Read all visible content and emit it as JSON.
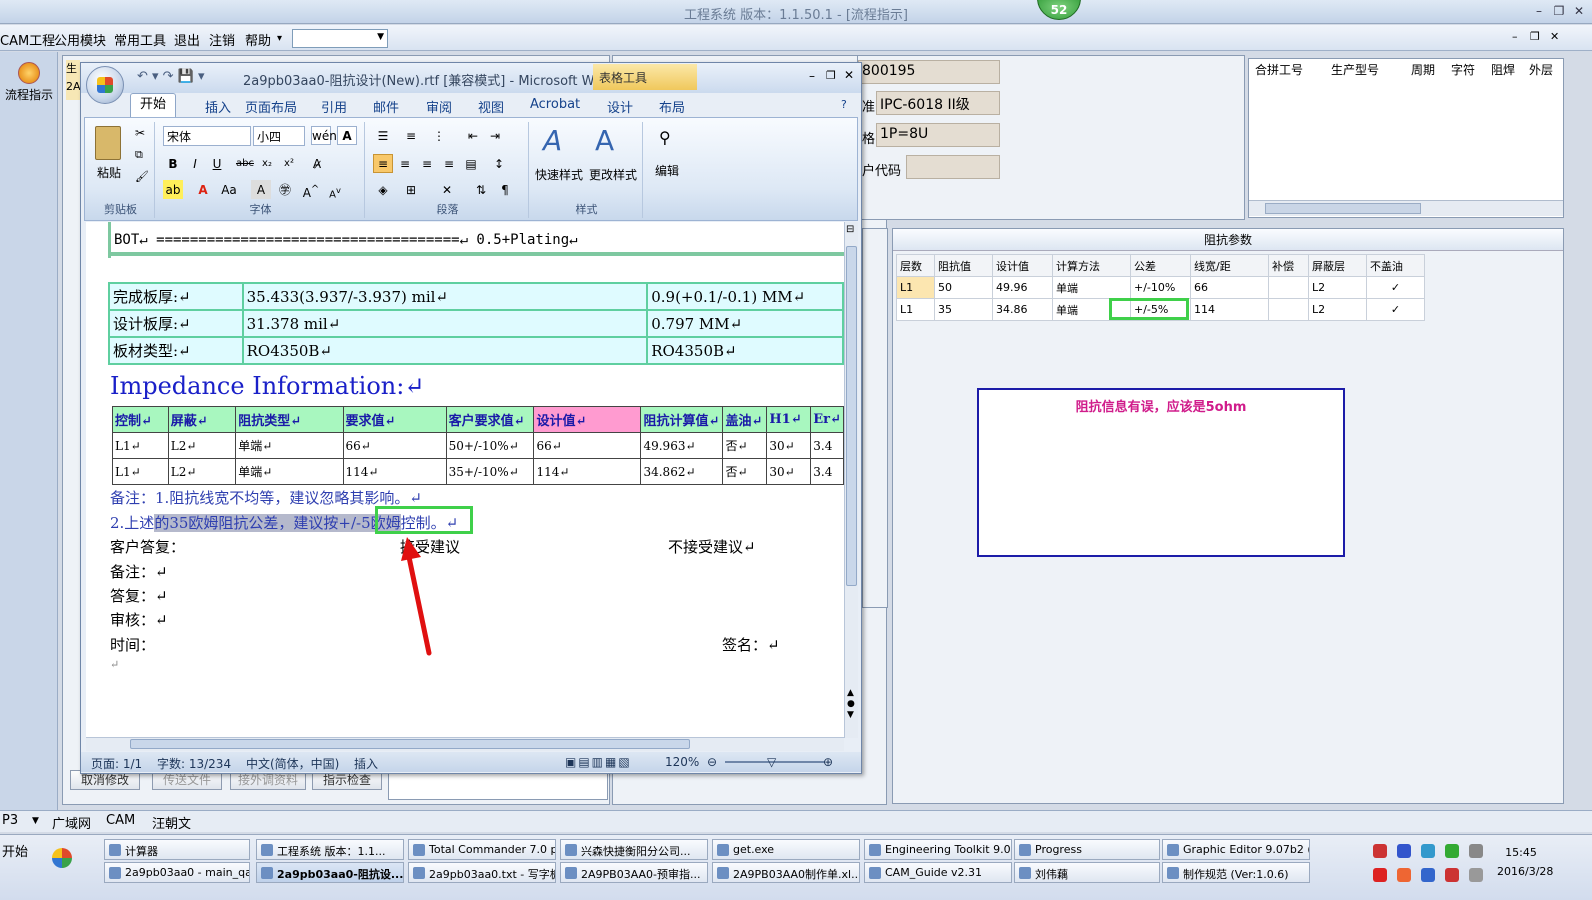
{
  "app": {
    "title": "工程系统   版本：1.1.50.1 - [流程指示]",
    "badge": "52",
    "menu": [
      "CAM工程",
      "公用模块",
      "常用工具",
      "退出",
      "注销",
      "帮助"
    ],
    "flow_btn": "流程指示",
    "frag_1": "生",
    "frag_2": "2A"
  },
  "fields": {
    "f1_value": "800195",
    "f2_label": "准",
    "f2_value": "IPC-6018 II级",
    "f3_label": "格",
    "f3_value": "1P=8U",
    "f4_label": "户代码",
    "f4_value": ""
  },
  "lot_table": {
    "headers": [
      "合拼工号",
      "生产型号",
      "周期",
      "字符",
      "阻焊",
      "外层"
    ]
  },
  "impedance_panel": {
    "title": "阻抗参数",
    "headers": [
      "层数",
      "阻抗值",
      "设计值",
      "计算方法",
      "公差",
      "线宽/距",
      "补偿",
      "屏蔽层",
      "不盖油"
    ],
    "rows": [
      [
        "L1",
        "50",
        "49.96",
        "单端",
        "+/-10%",
        "66",
        "",
        "L2",
        "✓"
      ],
      [
        "L1",
        "35",
        "34.86",
        "单端",
        "+/-5%",
        "114",
        "",
        "L2",
        "✓"
      ]
    ],
    "note": "阻抗信息有误，应该是5ohm"
  },
  "word": {
    "title": "2a9pb03aa0-阻抗设计(New).rtf [兼容模式] - Microsoft Wo...",
    "context_tab": "表格工具",
    "tabs": [
      "开始",
      "插入",
      "页面布局",
      "引用",
      "邮件",
      "审阅",
      "视图",
      "Acrobat",
      "设计",
      "布局"
    ],
    "ribbon": {
      "paste": "粘贴",
      "clipboard": "剪贴板",
      "font_name": "宋体",
      "font_size": "小四",
      "font": "字体",
      "paragraph": "段落",
      "quick_style": "快速样式",
      "change_style": "更改样式",
      "styles": "样式",
      "edit": "编辑"
    },
    "status": {
      "page": "页面: 1/1",
      "words": "字数: 13/234",
      "lang": "中文(简体，中国)",
      "mode": "插入",
      "zoom": "120%"
    }
  },
  "doc": {
    "bot": "BOT↵              ====================================↵           0.5+Plating↵",
    "thick_rows": [
      [
        "完成板厚:↵",
        "35.433(3.937/-3.937) mil↵",
        "0.9(+0.1/-0.1) MM↵"
      ],
      [
        "设计板厚:↵",
        "31.378 mil↵",
        "0.797 MM↵"
      ],
      [
        "板材类型:↵",
        "RO4350B↵",
        "RO4350B↵"
      ]
    ],
    "imp_heading": "Impedance Information:↵",
    "imp_headers": [
      "控制↵",
      "屏蔽↵",
      "阻抗类型↵",
      "要求值↵",
      "客户要求值↵",
      "设计值↵",
      "阻抗计算值↵",
      "盖油↵",
      "H1↵",
      "Er↵"
    ],
    "imp_rows": [
      [
        "L1↵",
        "L2↵",
        "单端↵",
        "66↵",
        "50+/-10%↵",
        "66↵",
        "49.963↵",
        "否↵",
        "30↵",
        "3.4"
      ],
      [
        "L1↵",
        "L2↵",
        "单端↵",
        "114↵",
        "35+/-10%↵",
        "114↵",
        "34.862↵",
        "否↵",
        "30↵",
        "3.4"
      ]
    ],
    "remark1": "备注：1.阻抗线宽不均等，建议忽略其影响。↵",
    "remark2a": "2.上述",
    "remark2b": "的35欧姆阻抗公差，建议按+/-5欧姆",
    "remark2c": "控制。↵",
    "reply": "客户答复：",
    "accept": "接受建议",
    "reject": "不接受建议↵",
    "note": "备注：↵",
    "answer": "答复：↵",
    "review": "审核：↵",
    "time": "时间：",
    "sign": "签名：↵",
    "end": "↵"
  },
  "buttons": [
    "取消修改",
    "传送文件",
    "接外调资料",
    "指示检查"
  ],
  "bottom_tabs": [
    "P3",
    "广域网",
    "CAM",
    "汪朝文"
  ],
  "taskbar": {
    "start": "开始",
    "row1": [
      "计算器",
      "工程系统   版本：1.1...",
      "Total Commander 7.0 p...",
      "兴森快捷衡阳分公司...",
      "get.exe",
      "Engineering Toolkit 9.0...",
      "Progress",
      "Graphic Editor 9.07b2 (..."
    ],
    "row2": [
      "2a9pb03aa0 - main_qa",
      "2a9pb03aa0-阻抗设...",
      "2a9pb03aa0.txt - 写字板",
      "2A9PB03AA0-预审指...",
      "2A9PB03AA0制作单.xl...",
      "CAM_Guide v2.31",
      "刘伟藕",
      "制作规范 (Ver:1.0.6)"
    ],
    "time": "15:45",
    "date": "2016/3/28"
  }
}
